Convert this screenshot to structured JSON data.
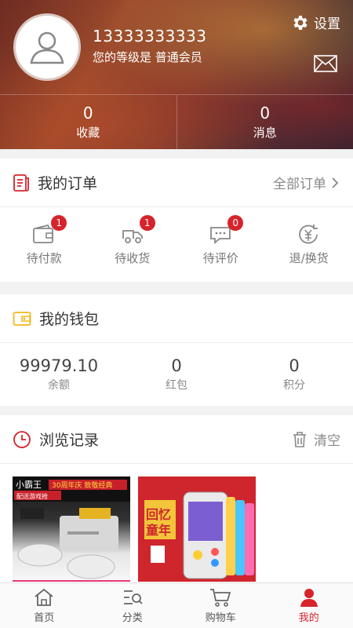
{
  "profile": {
    "phone": "13333333333",
    "level": "您的等级是 普通会员",
    "settings_label": "设置"
  },
  "stats": [
    {
      "value": "0",
      "label": "收藏"
    },
    {
      "value": "0",
      "label": "消息"
    }
  ],
  "orders": {
    "title": "我的订单",
    "all_label": "全部订单",
    "items": [
      {
        "label": "待付款",
        "badge": "1",
        "icon": "wallet-icon"
      },
      {
        "label": "待收货",
        "badge": "1",
        "icon": "truck-icon"
      },
      {
        "label": "待评价",
        "badge": "0",
        "icon": "comment-icon"
      },
      {
        "label": "退/换货",
        "icon": "refund-icon"
      }
    ]
  },
  "wallet": {
    "title": "我的钱包",
    "items": [
      {
        "value": "99979.10",
        "label": "余额"
      },
      {
        "value": "0",
        "label": "红包"
      },
      {
        "value": "0",
        "label": "积分"
      }
    ]
  },
  "history": {
    "title": "浏览记录",
    "clear_label": "清空",
    "products": [
      {
        "caption": "小霸王 30周年庆 致敬经典 配送游戏抢"
      },
      {
        "caption": "回忆童年"
      }
    ]
  },
  "tabs": [
    {
      "label": "首页",
      "icon": "home-icon"
    },
    {
      "label": "分类",
      "icon": "category-icon"
    },
    {
      "label": "购物车",
      "icon": "cart-icon"
    },
    {
      "label": "我的",
      "icon": "user-icon",
      "active": true
    }
  ],
  "colors": {
    "accent": "#d7232b",
    "wallet_icon": "#f3b81b"
  }
}
